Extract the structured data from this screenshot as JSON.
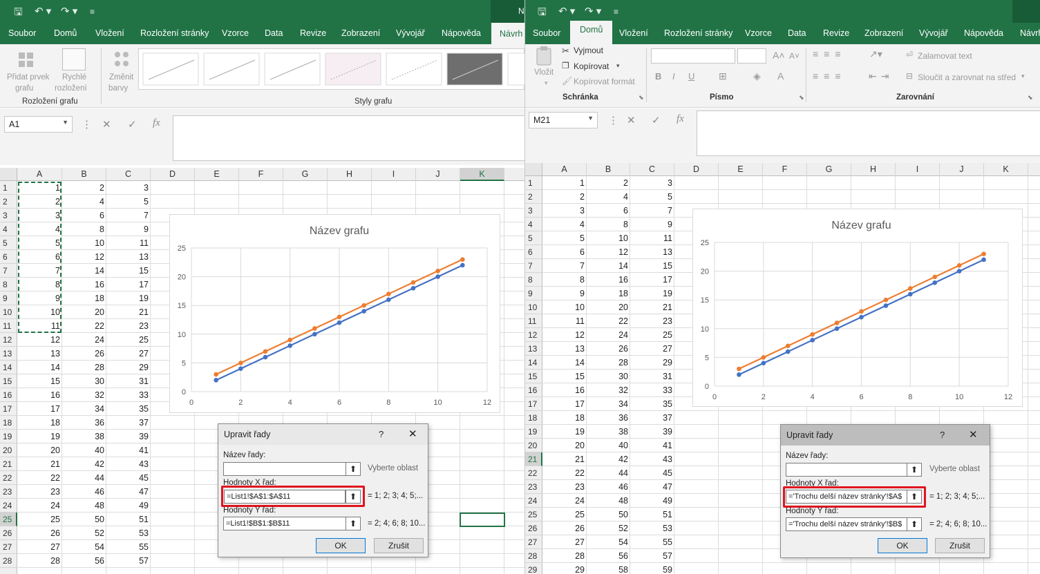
{
  "left": {
    "tabs": [
      "Soubor",
      "Domů",
      "Vložení",
      "Rozložení stránky",
      "Vzorce",
      "Data",
      "Revize",
      "Zobrazení",
      "Vývojář",
      "Nápověda",
      "Návrh g"
    ],
    "title_frag": "N",
    "ribbon": {
      "add_element": "Přidat prvek",
      "add_element2": "grafu",
      "quick_layout": "Rychlé",
      "quick_layout2": "rozložení",
      "change_colors": "Změnit",
      "change_colors2": "barvy",
      "group_layout": "Rozložení grafu",
      "group_styles": "Styly grafu"
    },
    "name_box": "A1",
    "fx": "fx",
    "columns": [
      "A",
      "B",
      "C",
      "D",
      "E",
      "F",
      "G",
      "H",
      "I",
      "J",
      "K"
    ],
    "rows": [
      [
        "1",
        "1",
        "2",
        "3"
      ],
      [
        "2",
        "2",
        "4",
        "5"
      ],
      [
        "3",
        "3",
        "6",
        "7"
      ],
      [
        "4",
        "4",
        "8",
        "9"
      ],
      [
        "5",
        "5",
        "10",
        "11"
      ],
      [
        "6",
        "6",
        "12",
        "13"
      ],
      [
        "7",
        "7",
        "14",
        "15"
      ],
      [
        "8",
        "8",
        "16",
        "17"
      ],
      [
        "9",
        "9",
        "18",
        "19"
      ],
      [
        "10",
        "10",
        "20",
        "21"
      ],
      [
        "11",
        "11",
        "22",
        "23"
      ],
      [
        "12",
        "12",
        "24",
        "25"
      ],
      [
        "13",
        "13",
        "26",
        "27"
      ],
      [
        "14",
        "14",
        "28",
        "29"
      ],
      [
        "15",
        "15",
        "30",
        "31"
      ],
      [
        "16",
        "16",
        "32",
        "33"
      ],
      [
        "17",
        "17",
        "34",
        "35"
      ],
      [
        "18",
        "18",
        "36",
        "37"
      ],
      [
        "19",
        "19",
        "38",
        "39"
      ],
      [
        "20",
        "20",
        "40",
        "41"
      ],
      [
        "21",
        "21",
        "42",
        "43"
      ],
      [
        "22",
        "22",
        "44",
        "45"
      ],
      [
        "23",
        "23",
        "46",
        "47"
      ],
      [
        "24",
        "24",
        "48",
        "49"
      ],
      [
        "25",
        "25",
        "50",
        "51"
      ],
      [
        "26",
        "26",
        "52",
        "53"
      ],
      [
        "27",
        "27",
        "54",
        "55"
      ],
      [
        "28",
        "28",
        "56",
        "57"
      ]
    ],
    "dialog": {
      "title": "Upravit řady",
      "help": "?",
      "close": "✕",
      "series_name_label": "Název řady:",
      "series_name_value": "",
      "series_name_hint": "Vyberte oblast",
      "x_label": "Hodnoty X řad:",
      "x_value": "=List1!$A$1:$A$11",
      "x_preview": "= 1; 2; 3; 4; 5;...",
      "y_label": "Hodnoty Y řad:",
      "y_value": "=List1!$B$1:$B$11",
      "y_preview": "= 2; 4; 6; 8; 10...",
      "ok": "OK",
      "cancel": "Zrušit"
    }
  },
  "right": {
    "tabs": [
      "Soubor",
      "Domů",
      "Vložení",
      "Rozložení stránky",
      "Vzorce",
      "Data",
      "Revize",
      "Zobrazení",
      "Vývojář",
      "Nápověda",
      "Návrh"
    ],
    "ribbon": {
      "paste": "Vložit",
      "cut": "Vyjmout",
      "copy": "Kopírovat",
      "format_painter": "Kopírovat formát",
      "group_clipboard": "Schránka",
      "group_font": "Písmo",
      "group_align": "Zarovnání",
      "wrap_text": "Zalamovat text",
      "merge_center": "Sloučit a zarovnat na střed",
      "bold": "B",
      "italic": "I",
      "underline": "U"
    },
    "name_box": "M21",
    "fx": "fx",
    "columns": [
      "A",
      "B",
      "C",
      "D",
      "E",
      "F",
      "G",
      "H",
      "I",
      "J",
      "K"
    ],
    "rows": [
      [
        "1",
        "1",
        "2",
        "3"
      ],
      [
        "2",
        "2",
        "4",
        "5"
      ],
      [
        "3",
        "3",
        "6",
        "7"
      ],
      [
        "4",
        "4",
        "8",
        "9"
      ],
      [
        "5",
        "5",
        "10",
        "11"
      ],
      [
        "6",
        "6",
        "12",
        "13"
      ],
      [
        "7",
        "7",
        "14",
        "15"
      ],
      [
        "8",
        "8",
        "16",
        "17"
      ],
      [
        "9",
        "9",
        "18",
        "19"
      ],
      [
        "10",
        "10",
        "20",
        "21"
      ],
      [
        "11",
        "11",
        "22",
        "23"
      ],
      [
        "12",
        "12",
        "24",
        "25"
      ],
      [
        "13",
        "13",
        "26",
        "27"
      ],
      [
        "14",
        "14",
        "28",
        "29"
      ],
      [
        "15",
        "15",
        "30",
        "31"
      ],
      [
        "16",
        "16",
        "32",
        "33"
      ],
      [
        "17",
        "17",
        "34",
        "35"
      ],
      [
        "18",
        "18",
        "36",
        "37"
      ],
      [
        "19",
        "19",
        "38",
        "39"
      ],
      [
        "20",
        "20",
        "40",
        "41"
      ],
      [
        "21",
        "21",
        "42",
        "43"
      ],
      [
        "22",
        "22",
        "44",
        "45"
      ],
      [
        "23",
        "23",
        "46",
        "47"
      ],
      [
        "24",
        "24",
        "48",
        "49"
      ],
      [
        "25",
        "25",
        "50",
        "51"
      ],
      [
        "26",
        "26",
        "52",
        "53"
      ],
      [
        "27",
        "27",
        "54",
        "55"
      ],
      [
        "28",
        "28",
        "56",
        "57"
      ],
      [
        "29",
        "29",
        "58",
        "59"
      ]
    ],
    "dialog": {
      "title": "Upravit řady",
      "help": "?",
      "close": "✕",
      "series_name_label": "Název řady:",
      "series_name_value": "",
      "series_name_hint": "Vyberte oblast",
      "x_label": "Hodnoty X řad:",
      "x_value": "='Trochu delší název stránky'!$A$",
      "x_preview": "= 1; 2; 3; 4; 5;...",
      "y_label": "Hodnoty Y řad:",
      "y_value": "='Trochu delší název stránky'!$B$",
      "y_preview": "= 2; 4; 6; 8; 10...",
      "ok": "OK",
      "cancel": "Zrušit"
    }
  },
  "chart_data": [
    {
      "type": "scatter",
      "title": "Název grafu",
      "xlim": [
        0,
        12
      ],
      "ylim": [
        0,
        25
      ],
      "xticks": [
        "0",
        "2",
        "4",
        "6",
        "8",
        "10",
        "12"
      ],
      "yticks": [
        "0",
        "5",
        "10",
        "15",
        "20",
        "25"
      ],
      "grid": true,
      "series": [
        {
          "color": "#4472c4",
          "x": [
            1,
            2,
            3,
            4,
            5,
            6,
            7,
            8,
            9,
            10,
            11
          ],
          "y": [
            2,
            4,
            6,
            8,
            10,
            12,
            14,
            16,
            18,
            20,
            22
          ]
        },
        {
          "color": "#ed7d31",
          "x": [
            1,
            2,
            3,
            4,
            5,
            6,
            7,
            8,
            9,
            10,
            11
          ],
          "y": [
            3,
            5,
            7,
            9,
            11,
            13,
            15,
            17,
            19,
            21,
            23
          ]
        }
      ]
    },
    {
      "type": "scatter",
      "title": "Název grafu",
      "xlim": [
        0,
        12
      ],
      "ylim": [
        0,
        25
      ],
      "xticks": [
        "0",
        "2",
        "4",
        "6",
        "8",
        "10",
        "12"
      ],
      "yticks": [
        "0",
        "5",
        "10",
        "15",
        "20",
        "25"
      ],
      "grid": true,
      "series": [
        {
          "color": "#4472c4",
          "x": [
            1,
            2,
            3,
            4,
            5,
            6,
            7,
            8,
            9,
            10,
            11
          ],
          "y": [
            2,
            4,
            6,
            8,
            10,
            12,
            14,
            16,
            18,
            20,
            22
          ]
        },
        {
          "color": "#ed7d31",
          "x": [
            1,
            2,
            3,
            4,
            5,
            6,
            7,
            8,
            9,
            10,
            11
          ],
          "y": [
            3,
            5,
            7,
            9,
            11,
            13,
            15,
            17,
            19,
            21,
            23
          ]
        }
      ]
    }
  ]
}
